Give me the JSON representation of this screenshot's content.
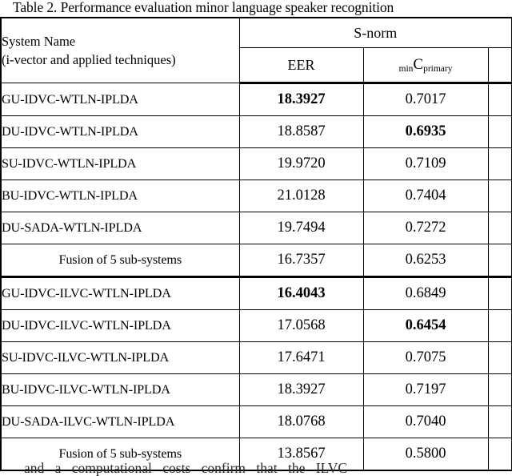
{
  "caption": "Table 2. Performance evaluation minor language speaker recognition",
  "table": {
    "header": {
      "system_name_line1": "System Name",
      "system_name_line2": "(i-vector and applied techniques)",
      "group_label": "S-norm",
      "col_eer": "EER",
      "col_mincp_prefix": "min",
      "col_mincp_c": "C",
      "col_mincp_suffix": "primary",
      "col_extra": ""
    },
    "columns": [
      "System Name (i-vector and applied techniques)",
      "EER",
      "minCprimary",
      ""
    ],
    "group1": {
      "rows": [
        {
          "system": "GU-IDVC-WTLN-IPLDA",
          "eer": "18.3927",
          "eer_bold": true,
          "mincp": "0.7017",
          "mincp_bold": false,
          "extra": ""
        },
        {
          "system": "DU-IDVC-WTLN-IPLDA",
          "eer": "18.8587",
          "eer_bold": false,
          "mincp": "0.6935",
          "mincp_bold": true,
          "extra": ""
        },
        {
          "system": "SU-IDVC-WTLN-IPLDA",
          "eer": "19.9720",
          "eer_bold": false,
          "mincp": "0.7109",
          "mincp_bold": false,
          "extra": ""
        },
        {
          "system": "BU-IDVC-WTLN-IPLDA",
          "eer": "21.0128",
          "eer_bold": false,
          "mincp": "0.7404",
          "mincp_bold": false,
          "extra": ""
        },
        {
          "system": "DU-SADA-WTLN-IPLDA",
          "eer": "19.7494",
          "eer_bold": false,
          "mincp": "0.7272",
          "mincp_bold": false,
          "extra": ""
        }
      ],
      "fusion": {
        "system": "Fusion of 5 sub-systems",
        "eer": "16.7357",
        "mincp": "0.6253",
        "extra": ""
      }
    },
    "group2": {
      "rows": [
        {
          "system": "GU-IDVC-ILVC-WTLN-IPLDA",
          "eer": "16.4043",
          "eer_bold": true,
          "mincp": "0.6849",
          "mincp_bold": false,
          "extra": ""
        },
        {
          "system": "DU-IDVC-ILVC-WTLN-IPLDA",
          "eer": "17.0568",
          "eer_bold": false,
          "mincp": "0.6454",
          "mincp_bold": true,
          "extra": ""
        },
        {
          "system": "SU-IDVC-ILVC-WTLN-IPLDA",
          "eer": "17.6471",
          "eer_bold": false,
          "mincp": "0.7075",
          "mincp_bold": false,
          "extra": ""
        },
        {
          "system": "BU-IDVC-ILVC-WTLN-IPLDA",
          "eer": "18.3927",
          "eer_bold": false,
          "mincp": "0.7197",
          "mincp_bold": false,
          "extra": ""
        },
        {
          "system": "DU-SADA-ILVC-WTLN-IPLDA",
          "eer": "18.0768",
          "eer_bold": false,
          "mincp": "0.7040",
          "mincp_bold": false,
          "extra": ""
        }
      ],
      "fusion": {
        "system": "Fusion of 5 sub-systems",
        "eer": "13.8567",
        "mincp": "0.5800",
        "extra": ""
      }
    }
  },
  "below_text": "and a  computational  costs  confirm  that  the  ILVC"
}
